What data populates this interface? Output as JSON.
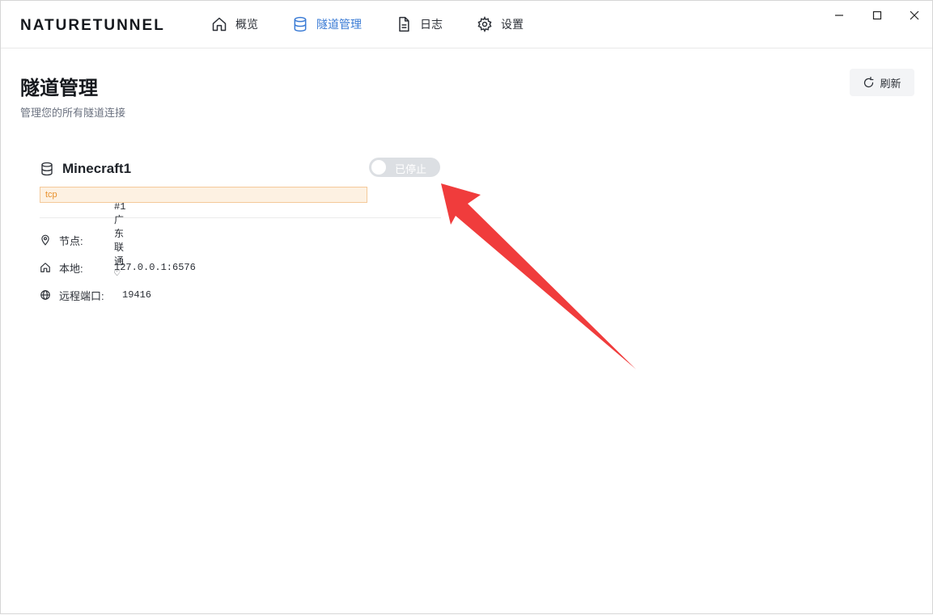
{
  "app": {
    "brand": "NATURETUNNEL"
  },
  "nav": [
    {
      "label": "概览",
      "icon": "home-icon",
      "active": false
    },
    {
      "label": "隧道管理",
      "icon": "database-icon",
      "active": true
    },
    {
      "label": "日志",
      "icon": "file-icon",
      "active": false
    },
    {
      "label": "设置",
      "icon": "gear-icon",
      "active": false
    }
  ],
  "window_controls": [
    "minimize-icon",
    "maximize-icon",
    "close-icon"
  ],
  "page": {
    "title": "隧道管理",
    "subtitle": "管理您的所有隧道连接",
    "refresh_label": "刷新"
  },
  "tunnel": {
    "name": "Minecraft1",
    "status_label": "已停止",
    "running": false,
    "protocol": "tcp",
    "node_label": "节点:",
    "node_value": "#1 广东联通 ♡",
    "local_label": "本地:",
    "local_value": "127.0.0.1:6576",
    "remote_label": "远程端口:",
    "remote_value": "19416"
  },
  "colors": {
    "accent": "#3a7bd5",
    "tag_bg": "#fdf1e2",
    "tag_text": "#e8912d",
    "toggle_off": "#dcdfe3",
    "annotation_arrow": "#f03c3c"
  }
}
